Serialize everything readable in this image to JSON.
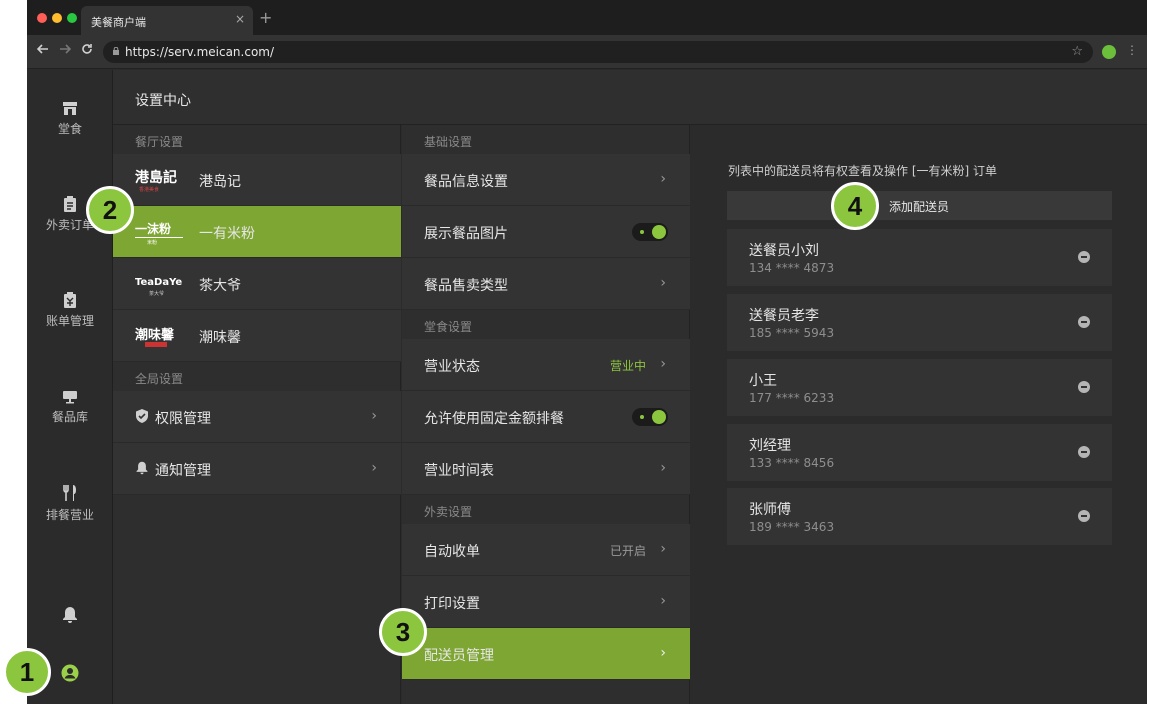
{
  "browser": {
    "tab_title": "美餐商户端",
    "tab_close": "×",
    "new_tab": "+",
    "url": "https://serv.meican.com/",
    "traffic_colors": [
      "#ff5f57",
      "#febc2e",
      "#28c840"
    ]
  },
  "rail": {
    "items": [
      {
        "label": "堂食",
        "icon": "storefront-icon"
      },
      {
        "label": "外卖订单",
        "icon": "clipboard-icon"
      },
      {
        "label": "账单管理",
        "icon": "bill-icon"
      },
      {
        "label": "餐品库",
        "icon": "monitor-icon"
      },
      {
        "label": "排餐营业",
        "icon": "utensils-icon"
      }
    ],
    "bottom_icons": [
      "bell-icon",
      "user-icon"
    ]
  },
  "header": {
    "title": "设置中心"
  },
  "restaurants": {
    "section_label": "餐厅设置",
    "items": [
      {
        "logo": "港島記",
        "logo_sub": "香港美食",
        "name": "港岛记"
      },
      {
        "logo": "一沫粉",
        "logo_sub": "米粉",
        "name": "一有米粉"
      },
      {
        "logo": "TeaDaYe",
        "logo_sub": "茶大爷",
        "name": "茶大爷"
      },
      {
        "logo": "潮味馨",
        "logo_sub": "",
        "name": "潮味馨"
      }
    ],
    "global_label": "全局设置",
    "global_items": [
      {
        "label": "权限管理",
        "icon": "shield-check-icon"
      },
      {
        "label": "通知管理",
        "icon": "bell-icon"
      }
    ]
  },
  "settings": {
    "basic_label": "基础设置",
    "basic_items": [
      {
        "label": "餐品信息设置"
      },
      {
        "label": "展示餐品图片",
        "toggle": true
      },
      {
        "label": "餐品售卖类型"
      }
    ],
    "dinein_label": "堂食设置",
    "dinein_items": [
      {
        "label": "营业状态",
        "value": "营业中"
      },
      {
        "label": "允许使用固定金额排餐",
        "toggle": true
      },
      {
        "label": "营业时间表"
      }
    ],
    "takeout_label": "外卖设置",
    "takeout_items": [
      {
        "label": "自动收单",
        "value": "已开启"
      },
      {
        "label": "打印设置"
      },
      {
        "label": "配送员管理"
      }
    ]
  },
  "couriers": {
    "note": "列表中的配送员将有权查看及操作 [一有米粉] 订单",
    "add_label": "添加配送员",
    "list": [
      {
        "name": "送餐员小刘",
        "phone": "134 **** 4873"
      },
      {
        "name": "送餐员老李",
        "phone": "185 **** 5943"
      },
      {
        "name": "小王",
        "phone": "177 **** 6233"
      },
      {
        "name": "刘经理",
        "phone": "133 **** 8456"
      },
      {
        "name": "张师傅",
        "phone": "189 **** 3463"
      }
    ]
  },
  "badges": [
    "1",
    "2",
    "3",
    "4"
  ],
  "colors": {
    "accent": "#7ea632",
    "badge": "#8cc63f",
    "status_green": "#8cc63f"
  }
}
